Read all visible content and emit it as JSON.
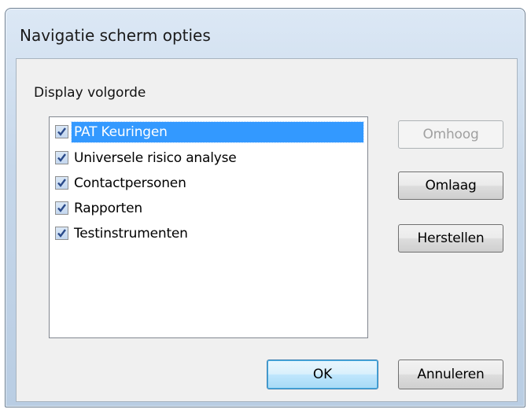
{
  "window": {
    "title": "Navigatie scherm opties"
  },
  "group": {
    "label": "Display volgorde"
  },
  "list": {
    "items": [
      {
        "label": "PAT Keuringen",
        "checked": true,
        "selected": true
      },
      {
        "label": "Universele risico analyse",
        "checked": true,
        "selected": false
      },
      {
        "label": "Contactpersonen",
        "checked": true,
        "selected": false
      },
      {
        "label": "Rapporten",
        "checked": true,
        "selected": false
      },
      {
        "label": "Testinstrumenten",
        "checked": true,
        "selected": false
      }
    ]
  },
  "buttons": {
    "up": "Omhoog",
    "down": "Omlaag",
    "reset": "Herstellen",
    "ok": "OK",
    "cancel": "Annuleren"
  },
  "colors": {
    "selection": "#3399ff",
    "titlebar": "#c6d7ea",
    "client": "#f0f0f0"
  }
}
